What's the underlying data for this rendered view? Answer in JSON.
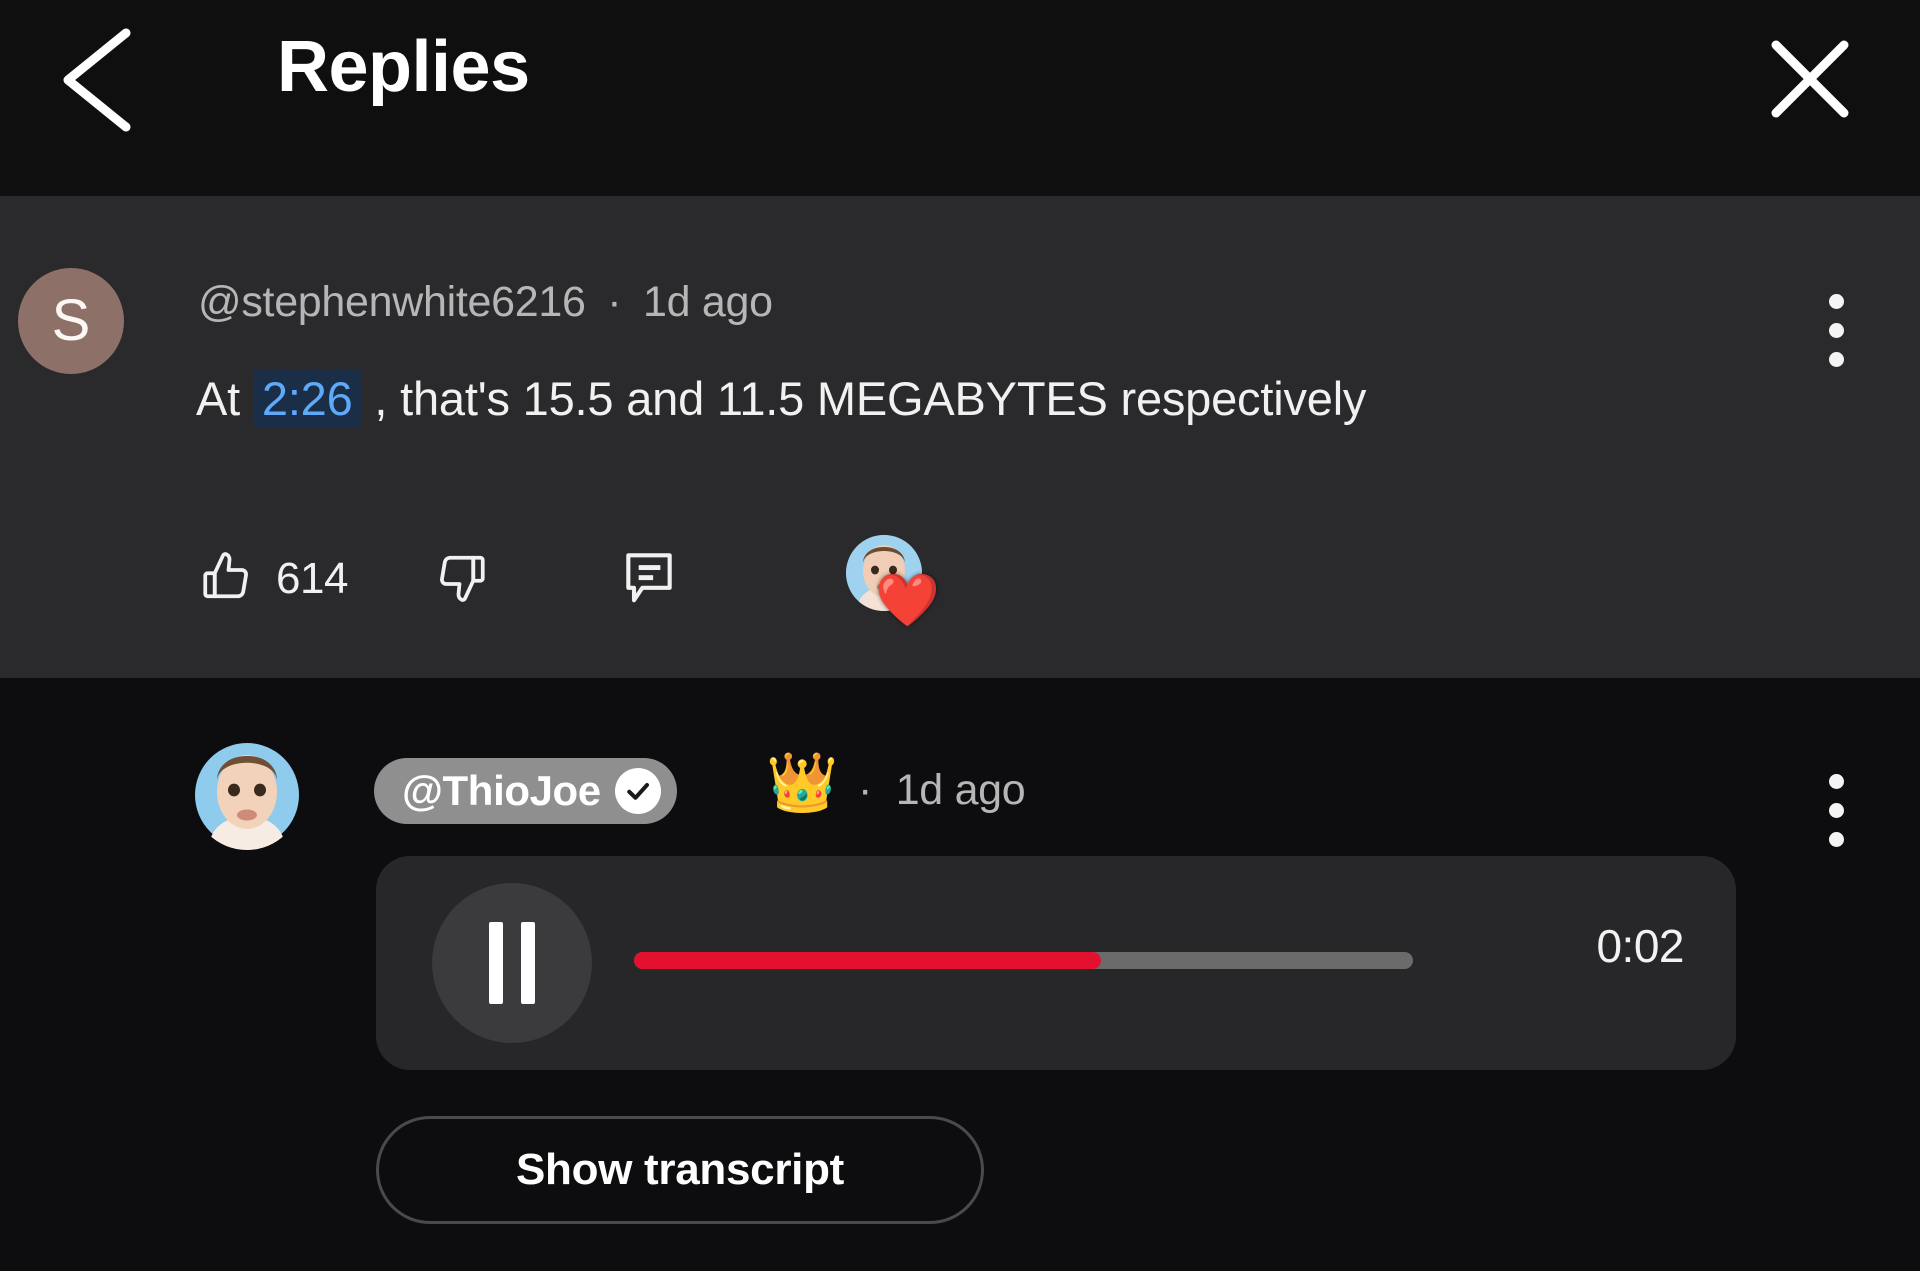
{
  "header": {
    "title": "Replies",
    "back_icon": "chevron-left-icon",
    "close_icon": "close-x-icon"
  },
  "comments": [
    {
      "author": "@stephenwhite6216",
      "separator": "·",
      "time": "1d ago",
      "meta": "@stephenwhite6216  ·  1d ago",
      "avatar_letter": "S",
      "avatar_color": "#8d7168",
      "text_before": "At",
      "timestamp_link": "2:26",
      "text_after": ", that's 15.5 and 11.5 MEGABYTES respectively",
      "like_count": "614",
      "like_icon": "thumbs-up-icon",
      "dislike_icon": "thumbs-down-icon",
      "reply_icon": "comment-bubble-icon",
      "creator_heart_icon": "creator-heart-icon",
      "more_icon": "kebab-menu-icon",
      "highlighted": true,
      "link_color": "#5ea9f8"
    },
    {
      "author": "@ThioJoe",
      "verified_icon": "verified-check-icon",
      "badge_icon": "crown-icon",
      "badge_emoji": "👑",
      "separator": "·",
      "time": "1d ago",
      "meta": "·  1d ago",
      "is_channel_owner": true,
      "owner_pill_color": "#8f8f8f",
      "more_icon": "kebab-menu-icon",
      "audio": {
        "state": "playing",
        "play_pause_icon": "pause-icon",
        "duration": "0:02",
        "progress_percent": 60,
        "progress_color": "#e4102f",
        "track_color": "#6b6b6b"
      },
      "transcript_button": "Show transcript"
    }
  ],
  "theme": {
    "page_background": "#0d0d0f",
    "highlight_background": "#2a2a2c",
    "text_primary": "#f1f1f1",
    "text_secondary": "#b6b6b6",
    "accent_red": "#e4102f"
  }
}
